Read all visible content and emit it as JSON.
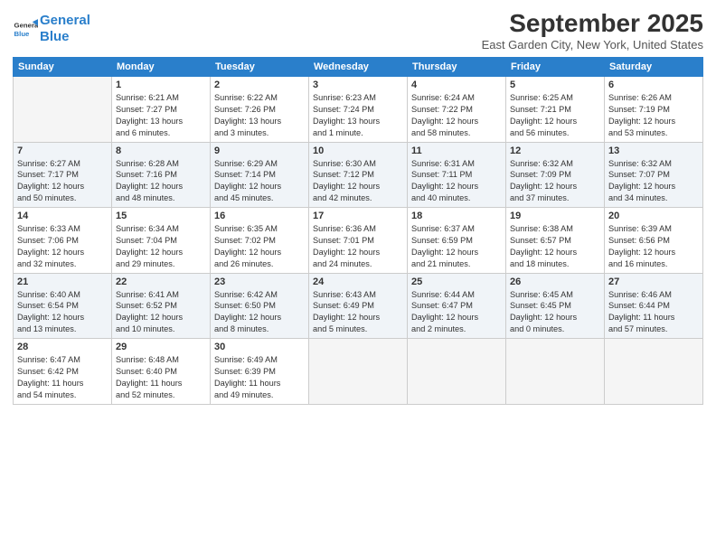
{
  "logo": {
    "line1": "General",
    "line2": "Blue"
  },
  "title": "September 2025",
  "location": "East Garden City, New York, United States",
  "days_of_week": [
    "Sunday",
    "Monday",
    "Tuesday",
    "Wednesday",
    "Thursday",
    "Friday",
    "Saturday"
  ],
  "weeks": [
    [
      {
        "day": "",
        "info": ""
      },
      {
        "day": "1",
        "info": "Sunrise: 6:21 AM\nSunset: 7:27 PM\nDaylight: 13 hours\nand 6 minutes."
      },
      {
        "day": "2",
        "info": "Sunrise: 6:22 AM\nSunset: 7:26 PM\nDaylight: 13 hours\nand 3 minutes."
      },
      {
        "day": "3",
        "info": "Sunrise: 6:23 AM\nSunset: 7:24 PM\nDaylight: 13 hours\nand 1 minute."
      },
      {
        "day": "4",
        "info": "Sunrise: 6:24 AM\nSunset: 7:22 PM\nDaylight: 12 hours\nand 58 minutes."
      },
      {
        "day": "5",
        "info": "Sunrise: 6:25 AM\nSunset: 7:21 PM\nDaylight: 12 hours\nand 56 minutes."
      },
      {
        "day": "6",
        "info": "Sunrise: 6:26 AM\nSunset: 7:19 PM\nDaylight: 12 hours\nand 53 minutes."
      }
    ],
    [
      {
        "day": "7",
        "info": "Sunrise: 6:27 AM\nSunset: 7:17 PM\nDaylight: 12 hours\nand 50 minutes."
      },
      {
        "day": "8",
        "info": "Sunrise: 6:28 AM\nSunset: 7:16 PM\nDaylight: 12 hours\nand 48 minutes."
      },
      {
        "day": "9",
        "info": "Sunrise: 6:29 AM\nSunset: 7:14 PM\nDaylight: 12 hours\nand 45 minutes."
      },
      {
        "day": "10",
        "info": "Sunrise: 6:30 AM\nSunset: 7:12 PM\nDaylight: 12 hours\nand 42 minutes."
      },
      {
        "day": "11",
        "info": "Sunrise: 6:31 AM\nSunset: 7:11 PM\nDaylight: 12 hours\nand 40 minutes."
      },
      {
        "day": "12",
        "info": "Sunrise: 6:32 AM\nSunset: 7:09 PM\nDaylight: 12 hours\nand 37 minutes."
      },
      {
        "day": "13",
        "info": "Sunrise: 6:32 AM\nSunset: 7:07 PM\nDaylight: 12 hours\nand 34 minutes."
      }
    ],
    [
      {
        "day": "14",
        "info": "Sunrise: 6:33 AM\nSunset: 7:06 PM\nDaylight: 12 hours\nand 32 minutes."
      },
      {
        "day": "15",
        "info": "Sunrise: 6:34 AM\nSunset: 7:04 PM\nDaylight: 12 hours\nand 29 minutes."
      },
      {
        "day": "16",
        "info": "Sunrise: 6:35 AM\nSunset: 7:02 PM\nDaylight: 12 hours\nand 26 minutes."
      },
      {
        "day": "17",
        "info": "Sunrise: 6:36 AM\nSunset: 7:01 PM\nDaylight: 12 hours\nand 24 minutes."
      },
      {
        "day": "18",
        "info": "Sunrise: 6:37 AM\nSunset: 6:59 PM\nDaylight: 12 hours\nand 21 minutes."
      },
      {
        "day": "19",
        "info": "Sunrise: 6:38 AM\nSunset: 6:57 PM\nDaylight: 12 hours\nand 18 minutes."
      },
      {
        "day": "20",
        "info": "Sunrise: 6:39 AM\nSunset: 6:56 PM\nDaylight: 12 hours\nand 16 minutes."
      }
    ],
    [
      {
        "day": "21",
        "info": "Sunrise: 6:40 AM\nSunset: 6:54 PM\nDaylight: 12 hours\nand 13 minutes."
      },
      {
        "day": "22",
        "info": "Sunrise: 6:41 AM\nSunset: 6:52 PM\nDaylight: 12 hours\nand 10 minutes."
      },
      {
        "day": "23",
        "info": "Sunrise: 6:42 AM\nSunset: 6:50 PM\nDaylight: 12 hours\nand 8 minutes."
      },
      {
        "day": "24",
        "info": "Sunrise: 6:43 AM\nSunset: 6:49 PM\nDaylight: 12 hours\nand 5 minutes."
      },
      {
        "day": "25",
        "info": "Sunrise: 6:44 AM\nSunset: 6:47 PM\nDaylight: 12 hours\nand 2 minutes."
      },
      {
        "day": "26",
        "info": "Sunrise: 6:45 AM\nSunset: 6:45 PM\nDaylight: 12 hours\nand 0 minutes."
      },
      {
        "day": "27",
        "info": "Sunrise: 6:46 AM\nSunset: 6:44 PM\nDaylight: 11 hours\nand 57 minutes."
      }
    ],
    [
      {
        "day": "28",
        "info": "Sunrise: 6:47 AM\nSunset: 6:42 PM\nDaylight: 11 hours\nand 54 minutes."
      },
      {
        "day": "29",
        "info": "Sunrise: 6:48 AM\nSunset: 6:40 PM\nDaylight: 11 hours\nand 52 minutes."
      },
      {
        "day": "30",
        "info": "Sunrise: 6:49 AM\nSunset: 6:39 PM\nDaylight: 11 hours\nand 49 minutes."
      },
      {
        "day": "",
        "info": ""
      },
      {
        "day": "",
        "info": ""
      },
      {
        "day": "",
        "info": ""
      },
      {
        "day": "",
        "info": ""
      }
    ]
  ]
}
